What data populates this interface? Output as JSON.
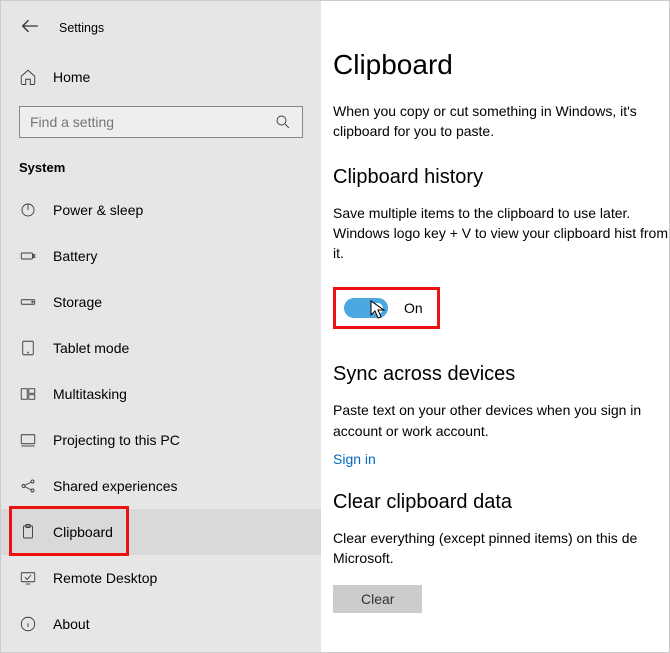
{
  "header": {
    "title": "Settings"
  },
  "home": {
    "label": "Home"
  },
  "search": {
    "placeholder": "Find a setting"
  },
  "group": {
    "label": "System"
  },
  "nav": [
    {
      "label": "Power & sleep"
    },
    {
      "label": "Battery"
    },
    {
      "label": "Storage"
    },
    {
      "label": "Tablet mode"
    },
    {
      "label": "Multitasking"
    },
    {
      "label": "Projecting to this PC"
    },
    {
      "label": "Shared experiences"
    },
    {
      "label": "Clipboard"
    },
    {
      "label": "Remote Desktop"
    },
    {
      "label": "About"
    }
  ],
  "main": {
    "title": "Clipboard",
    "intro": "When you copy or cut something in Windows, it's clipboard for you to paste.",
    "history": {
      "heading": "Clipboard history",
      "desc": "Save multiple items to the clipboard to use later. Windows logo key + V to view your clipboard hist from it.",
      "toggle_label": "On"
    },
    "sync": {
      "heading": "Sync across devices",
      "desc": "Paste text on your other devices when you sign in account or work account.",
      "link": "Sign in"
    },
    "clear": {
      "heading": "Clear clipboard data",
      "desc": "Clear everything (except pinned items) on this de Microsoft.",
      "button": "Clear"
    }
  }
}
